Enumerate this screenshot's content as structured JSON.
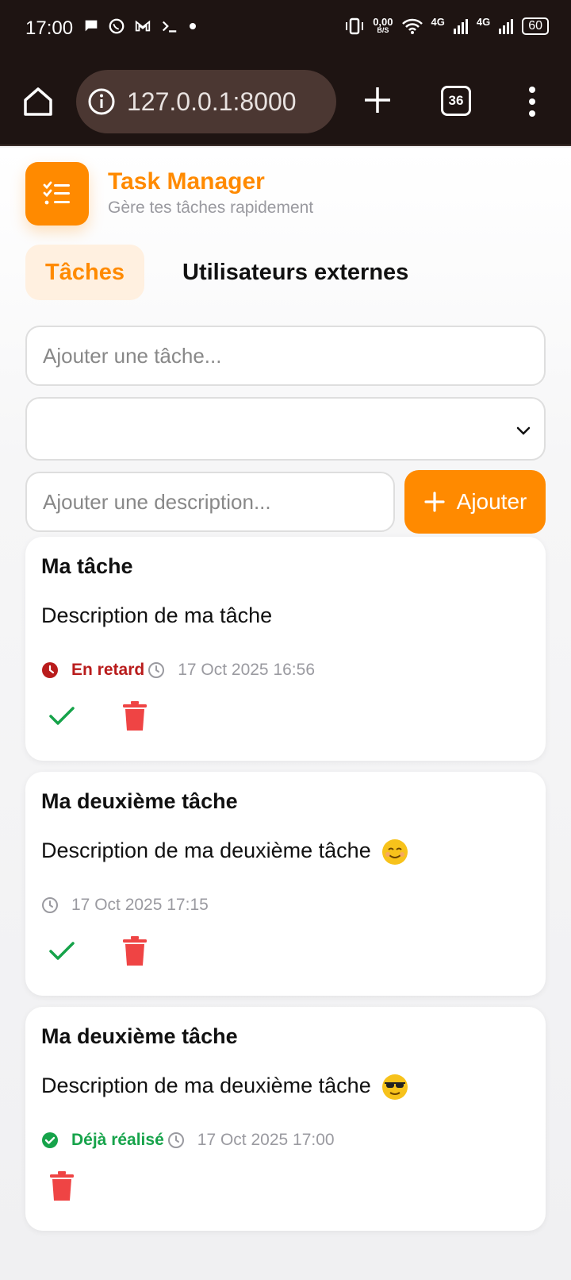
{
  "status_bar": {
    "time": "17:00",
    "net_speed_value": "0,00",
    "net_speed_unit": "B/S",
    "network_1": "4G",
    "network_2": "4G",
    "battery": "60"
  },
  "browser": {
    "url": "127.0.0.1:8000",
    "tab_count": "36"
  },
  "app": {
    "title": "Task Manager",
    "subtitle": "Gère tes tâches rapidement"
  },
  "tabs": {
    "tasks": "Tâches",
    "external_users": "Utilisateurs externes"
  },
  "form": {
    "title_placeholder": "Ajouter une tâche...",
    "select_value": "",
    "description_placeholder": "Ajouter une description...",
    "add_button": "Ajouter"
  },
  "tasks": [
    {
      "title": "Ma tâche",
      "description": "Description de ma tâche",
      "status": "En retard",
      "date": "17 Oct 2025 16:56"
    },
    {
      "title": "Ma deuxième tâche",
      "description": "Description de ma deuxième tâche",
      "date": "17 Oct 2025 17:15"
    },
    {
      "title": "Ma deuxième tâche",
      "description": "Description de ma deuxième tâche",
      "status": "Déjà réalisé",
      "date": "17 Oct 2025 17:00"
    }
  ],
  "colors": {
    "accent": "#ff8a00",
    "late": "#b91c1c",
    "done": "#16a34a",
    "delete": "#ef4444",
    "browser_bg": "#1e1412"
  },
  "icons": [
    "home-icon",
    "info-icon",
    "plus-icon",
    "tabs-icon",
    "more-vert-icon",
    "tasklist-icon",
    "chevron-down-icon",
    "clock-icon",
    "check-icon",
    "trash-icon",
    "alarm-icon",
    "check-circle-icon"
  ]
}
